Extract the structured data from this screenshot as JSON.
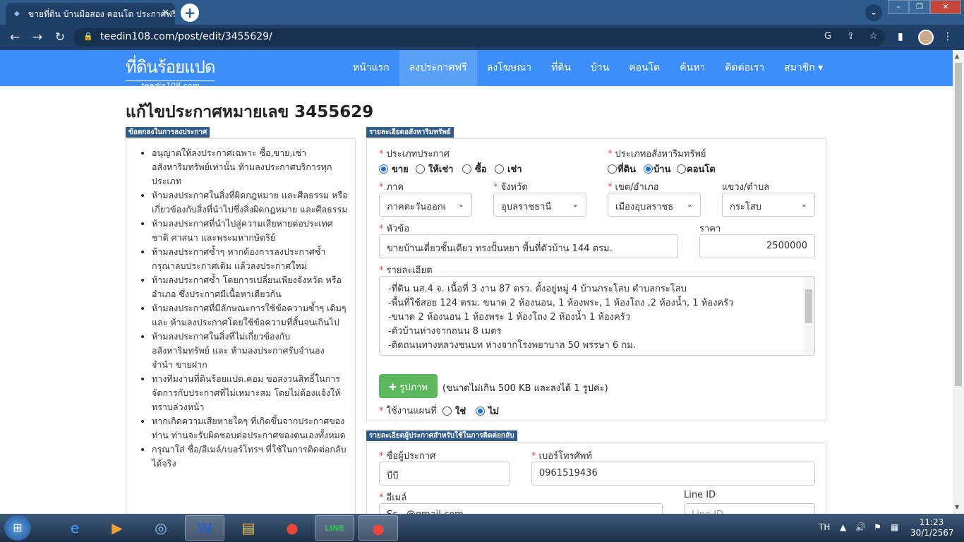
{
  "browser": {
    "tab_title": "ขายที่ดิน บ้านมือสอง คอนโด ประกาศฟรี",
    "url": "teedin108.com/post/edit/3455629/"
  },
  "site": {
    "logo_text": "ที่ดินร้อยแปด",
    "logo_sub": "teedin108.com",
    "menu": [
      {
        "label": "หน้าแรก"
      },
      {
        "label": "ลงประกาศฟรี"
      },
      {
        "label": "ลงโฆษณา"
      },
      {
        "label": "ที่ดิน"
      },
      {
        "label": "บ้าน"
      },
      {
        "label": "คอนโด"
      },
      {
        "label": "ค้นหา"
      },
      {
        "label": "ติดต่อเรา"
      },
      {
        "label": "สมาชิก ▾"
      }
    ]
  },
  "page": {
    "title": "แก้ไขประกาศหมายเลข 3455629"
  },
  "rules": {
    "heading": "ข้อตกลงในการลงประกาศ",
    "items": [
      "อนุญาตให้ลงประกาศเฉพาะ ซื้อ,ขาย,เช่า อสังหาริมทรัพย์เท่านั้น ห้ามลงประกาศบริการทุกประเภท",
      "ห้ามลงประกาศในสิ่งที่ผิดกฎหมาย และศีลธรรม หรือเกี่ยวข้องกับสิ่งที่นำไปซึ่งสิ่งผิดกฎหมาย และศีลธรรม",
      "ห้ามลงประกาศที่นำไปสู่ความเสียหายต่อประเทศชาติ ศาสนา และพระมหากษัตริย์",
      "ห้ามลงประกาศซ้ำๆ หากต้องการลงประกาศซ้ำ กรุณาลบประกาศเดิม แล้วลงประกาศใหม่",
      "ห้ามลงประกาศซ้ำ โดยการเปลี่ยนเพียงจังหวัด หรือ อำเภอ ซึ่งประกาศมีเนื้อหาเดียวกัน",
      "ห้ามลงประกาศที่มีลักษณะการใช้ข้อความซ้ำๆ เดิมๆ และ ห้ามลงประกาศโดยใช้ข้อความที่สั้นจนเกินไป",
      "ห้ามลงประกาศในสิ่งที่ไม่เกี่ยวข้องกับอสังหาริมทรัพย์ และ ห้ามลงประกาศรับจำนอง จำนำ ขายฝาก",
      "ทางทีมงานที่ดินร้อยแปด.คอม ขอสงวนสิทธิ์ในการจัดการกับประกาศที่ไม่เหมาะสม โดยไม่ต้องแจ้งให้ทราบล่วงหน้า",
      "หากเกิดความเสียหายใดๆ ที่เกิดขึ้นจากประกาศของท่าน ท่านจะรับผิดชอบต่อประกาศของตนเองทั้งหมด",
      "กรุณาใส่ ชื่อ/อีเมล์/เบอร์โทรฯ ที่ใช้ในการติดต่อกลับได้จริง"
    ]
  },
  "details": {
    "heading": "รายละเอียดอสังหาริมทรัพย์",
    "post_type_label": "ประเภทประกาศ",
    "post_types": [
      {
        "label": "ขาย",
        "checked": true
      },
      {
        "label": "ให้เช่า",
        "checked": false
      },
      {
        "label": "ซื้อ",
        "checked": false
      },
      {
        "label": "เช่า",
        "checked": false
      }
    ],
    "property_type_label": "ประเภทอสังหาริมทรัพย์",
    "property_types": [
      {
        "label": "ที่ดิน",
        "checked": false
      },
      {
        "label": "บ้าน",
        "checked": true
      },
      {
        "label": "คอนโด",
        "checked": false
      }
    ],
    "region_label": "ภาค",
    "region_value": "ภาคตะวันออกเ",
    "province_label": "จังหวัด",
    "province_value": "อุบลราชธานี",
    "district_label": "เขต/อำเภอ",
    "district_value": "เมืองอุบลราชธ",
    "subdistrict_label": "แขวง/ตำบล",
    "subdistrict_value": "กระโสบ",
    "subject_label": "หัวข้อ",
    "subject_value": "ขายบ้านเดี่ยวชั้นเดียว ทรงปั้นหยา พื้นที่ตัวบ้าน 144 ตรม.",
    "price_label": "ราคา",
    "price_value": "2500000",
    "description_label": "รายละเอียด",
    "description_lines": [
      "-ที่ดิน นส.4 จ. เนื้อที่ 3 งาน 87 ตรว.  ตั้งอยู่หมู่ 4 บ้านกระโสบ ตำบลกระโสบ",
      "-พื้นที่ใช้สอย 124 ตรม. ขนาด 2 ห้องนอน, 1 ห้องพระ, 1 ห้องโถง ,2 ห้องน้ำ, 1 ห้องครัว",
      "-ขนาด 2 ห้องนอน 1 ห้องพระ 1 ห้องโถง 2 ห้องน้ำ 1 ห้องครัว",
      "-ตัวบ้านห่างจากถนน 8 เมตร",
      "-ติดถนนทางหลวงชนบท ห่างจากโรงพยาบาล 50 พรรษา 6 กม."
    ],
    "image_button": "รูปภาพ",
    "image_note": "(ขนาดไม่เกิน 500 KB และลงได้ 1 รูปค่ะ)",
    "map_label": "ใช้งานแผนที่",
    "map_options": [
      {
        "label": "ใช่",
        "checked": false
      },
      {
        "label": "ไม่",
        "checked": true
      }
    ]
  },
  "contact": {
    "heading": "รายละเอียดผู้ประกาศสำหรับใช้ในการติดต่อกลับ",
    "name_label": "ชื่อผู้ประกาศ",
    "name_value": "บีบี",
    "phone_label": "เบอร์โทรศัพท์",
    "phone_value": "0961519436",
    "email_label": "อีเมล์",
    "email_value": "Sc...@gmail.com",
    "line_label": "Line ID",
    "line_placeholder": "Line ID"
  },
  "taskbar": {
    "lang": "TH",
    "time": "11:23",
    "date": "30/1/2567"
  }
}
